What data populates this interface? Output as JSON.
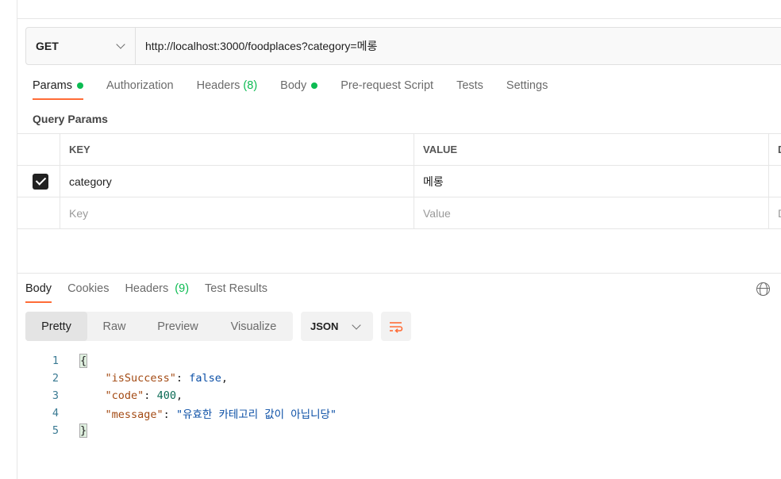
{
  "request": {
    "method": "GET",
    "url": "http://localhost:3000/foodplaces?category=메롱"
  },
  "request_tabs": [
    {
      "label": "Params",
      "dot": true,
      "count": ""
    },
    {
      "label": "Authorization",
      "dot": false,
      "count": ""
    },
    {
      "label": "Headers",
      "dot": false,
      "count": "(8)"
    },
    {
      "label": "Body",
      "dot": true,
      "count": ""
    },
    {
      "label": "Pre-request Script",
      "dot": false,
      "count": ""
    },
    {
      "label": "Tests",
      "dot": false,
      "count": ""
    },
    {
      "label": "Settings",
      "dot": false,
      "count": ""
    }
  ],
  "query_params": {
    "title": "Query Params",
    "headers": {
      "key": "KEY",
      "value": "VALUE",
      "desc": "D"
    },
    "rows": [
      {
        "checked": true,
        "key": "category",
        "value": "메롱"
      }
    ],
    "placeholder_key": "Key",
    "placeholder_value": "Value",
    "placeholder_desc": "D"
  },
  "response_tabs": [
    {
      "label": "Body",
      "count": ""
    },
    {
      "label": "Cookies",
      "count": ""
    },
    {
      "label": "Headers",
      "count": "(9)"
    },
    {
      "label": "Test Results",
      "count": ""
    }
  ],
  "view_modes": [
    "Pretty",
    "Raw",
    "Preview",
    "Visualize"
  ],
  "format": "JSON",
  "code_lines": {
    "l1": "{",
    "l2_key": "\"isSuccess\"",
    "l2_val": "false",
    "l3_key": "\"code\"",
    "l3_val": "400",
    "l4_key": "\"message\"",
    "l4_val": "\"유효한 카테고리 값이 아닙니당\"",
    "l5": "}"
  },
  "line_numbers": [
    "1",
    "2",
    "3",
    "4",
    "5"
  ]
}
